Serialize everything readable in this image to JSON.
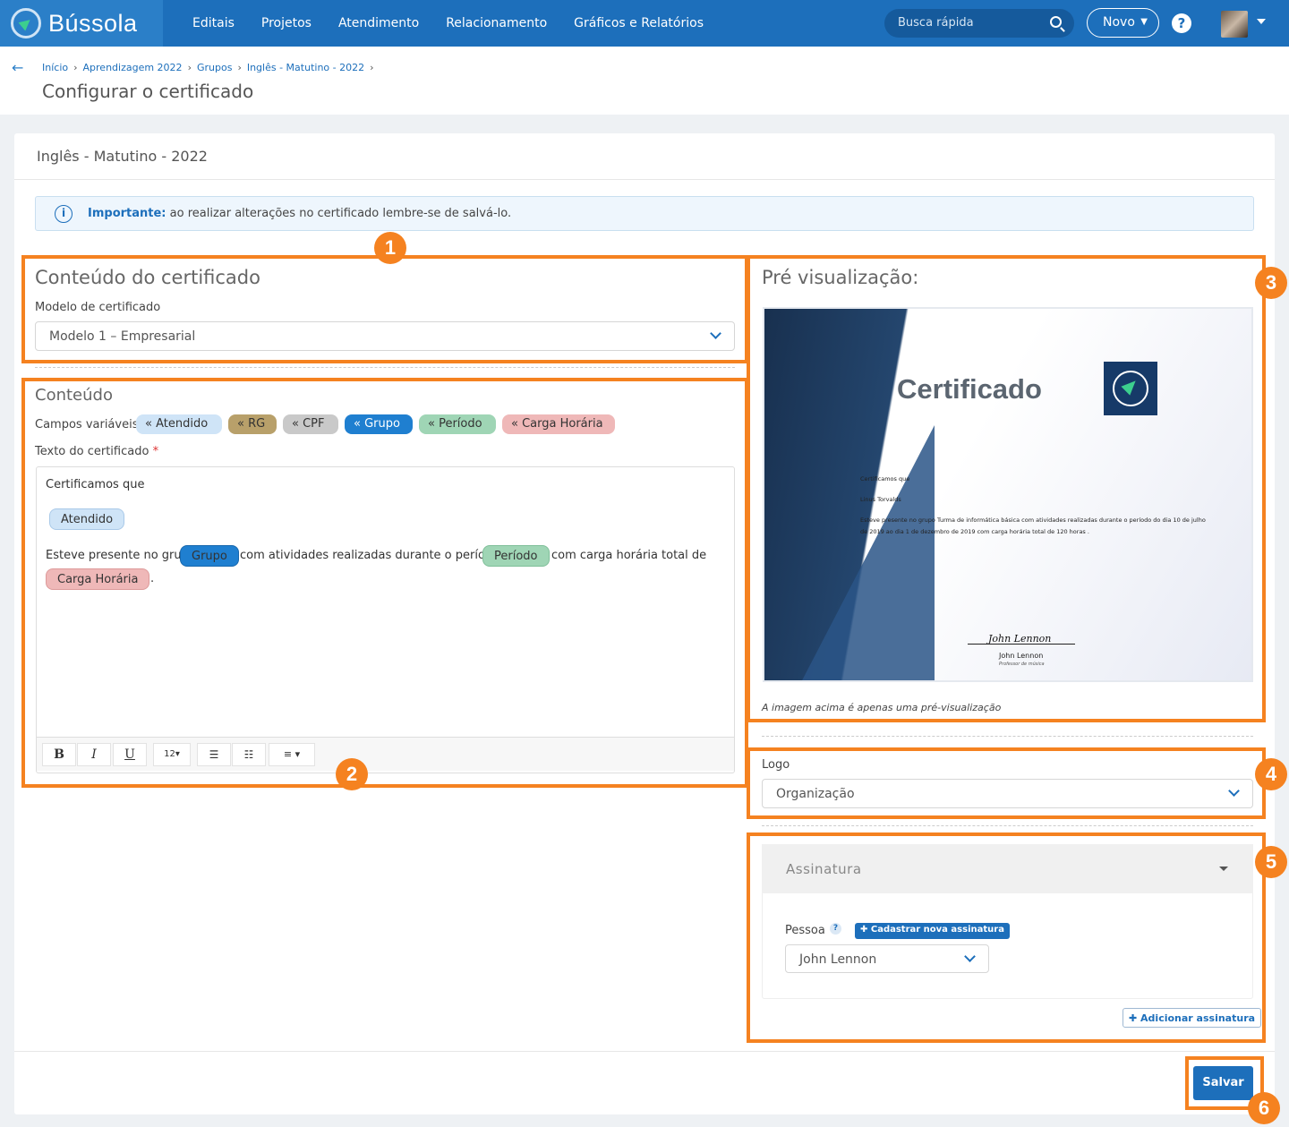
{
  "app": {
    "brand": "Bússola",
    "nav": [
      "Editais",
      "Projetos",
      "Atendimento",
      "Relacionamento",
      "Gráficos e Relatórios"
    ],
    "search_placeholder": "Busca rápida",
    "novo": "Novo",
    "help": "?"
  },
  "breadcrumb": [
    "Início",
    "Aprendizagem 2022",
    "Grupos",
    "Inglês - Matutino - 2022"
  ],
  "page_title": "Configurar o certificado",
  "card_title": "Inglês - Matutino - 2022",
  "alert": {
    "strong": "Importante:",
    "text": " ao realizar alterações no certificado lembre-se de salvá-lo."
  },
  "content": {
    "heading": "Conteúdo do certificado",
    "model_label": "Modelo de certificado",
    "model_value": "Modelo 1 – Empresarial"
  },
  "conteudo": {
    "heading": "Conteúdo",
    "fields_label": "Campos variáveis:",
    "fields": [
      {
        "label": "« Atendido",
        "color": "#cfe4f7"
      },
      {
        "label": "« RG",
        "color": "#b8a06a"
      },
      {
        "label": "« CPF",
        "color": "#c9c9c9"
      },
      {
        "label": "« Grupo",
        "color": "#1f7fd0"
      },
      {
        "label": "« Período",
        "color": "#9fd5b5"
      },
      {
        "label": "« Carga Horária",
        "color": "#efb8b8"
      }
    ],
    "text_label": "Texto do certificado",
    "required": "*"
  },
  "editor": {
    "line1": "Certificamos que",
    "pill_atendido": "Atendido",
    "line2a": "Esteve presente no grupo",
    "pill_grupo": "Grupo",
    "line2b": "com atividades realizadas durante o período do",
    "pill_periodo": "Período",
    "line2c": "com carga horária total de",
    "pill_carga": "Carga Horária",
    "dot": ".",
    "toolbar": {
      "bold": "B",
      "italic": "I",
      "underline": "U",
      "size": "12▾",
      "ul": "☰",
      "ol": "☷",
      "align": "≡ ▾"
    }
  },
  "preview": {
    "heading": "Pré visualização:",
    "cert_title": "Certificado",
    "l1": "Certificamos que",
    "l2": "Linus Torvalds",
    "l3": "Esteve presente no grupo  Turma de informática básica com atividades realizadas durante o período do dia 10 de julho",
    "l4": "de 2019 ao dia 1 de dezembro de 2019 com carga horária total de  120 horas .",
    "sig_script": "John Lennon",
    "sig_name": "John Lennon",
    "sig_role": "Professor de música",
    "note": "A imagem acima é apenas uma pré-visualização"
  },
  "logo": {
    "label": "Logo",
    "value": "Organização"
  },
  "assinatura": {
    "heading": "Assinatura",
    "pessoa_label": "Pessoa",
    "help": "?",
    "new_btn": "✚ Cadastrar nova assinatura",
    "person_value": "John Lennon",
    "add_btn": "✚ Adicionar assinatura"
  },
  "save": "Salvar",
  "badges": [
    "1",
    "2",
    "3",
    "4",
    "5",
    "6"
  ],
  "colors": {
    "highlight": "#f58220",
    "primary": "#1d6fbb"
  }
}
